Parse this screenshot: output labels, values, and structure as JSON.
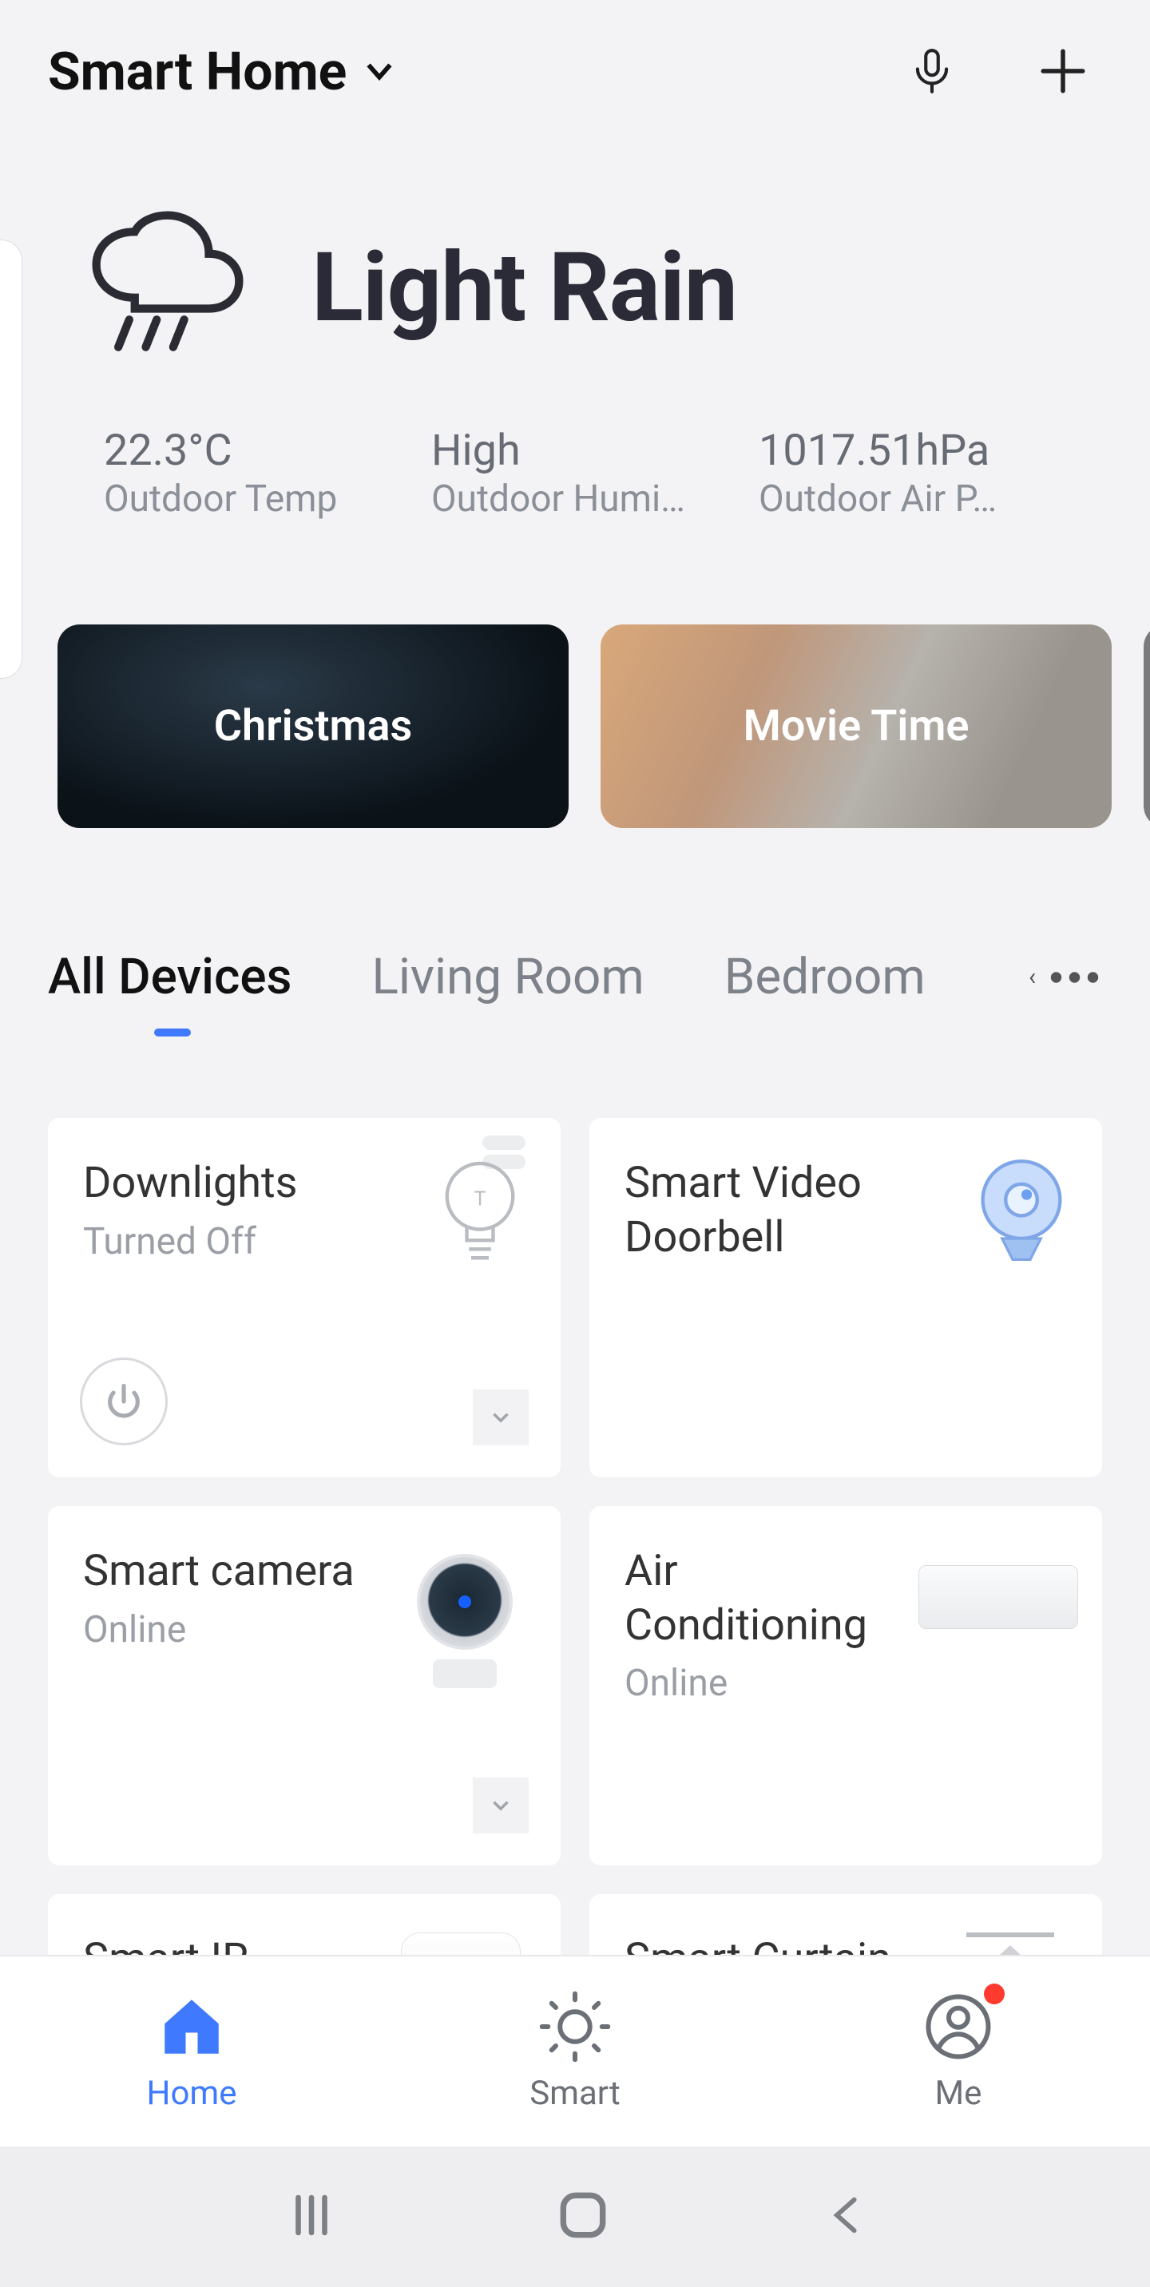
{
  "header": {
    "title": "Smart Home"
  },
  "weather": {
    "condition": "Light Rain",
    "temp_value": "22.3°C",
    "temp_label": "Outdoor Temp",
    "hum_value": "High",
    "hum_label": "Outdoor Humi…",
    "press_value": "1017.51hPa",
    "press_label": "Outdoor Air P…"
  },
  "scenes": [
    {
      "name": "Christmas"
    },
    {
      "name": "Movie Time"
    }
  ],
  "rooms": {
    "tabs": [
      "All Devices",
      "Living Room",
      "Bedroom"
    ],
    "active_index": 0
  },
  "devices": [
    {
      "name": "Downlights",
      "status": "Turned Off",
      "icon": "bulb",
      "has_power": true,
      "has_chevron": true
    },
    {
      "name": "Smart Video Doorbell",
      "status": "",
      "icon": "doorbell",
      "has_power": false,
      "has_chevron": false
    },
    {
      "name": "Smart camera",
      "status": "Online",
      "icon": "camera",
      "has_power": false,
      "has_chevron": true
    },
    {
      "name": "Air Conditioning",
      "status": "Online",
      "icon": "ac",
      "has_power": false,
      "has_chevron": false
    },
    {
      "name": "Smart IR",
      "status": "",
      "icon": "ir",
      "has_power": false,
      "has_chevron": false
    },
    {
      "name": "Smart Curtain",
      "status": "",
      "icon": "curtain",
      "has_power": false,
      "has_chevron": false
    }
  ],
  "bottomnav": {
    "items": [
      "Home",
      "Smart",
      "Me"
    ],
    "active_index": 0,
    "badge_index": 2
  }
}
